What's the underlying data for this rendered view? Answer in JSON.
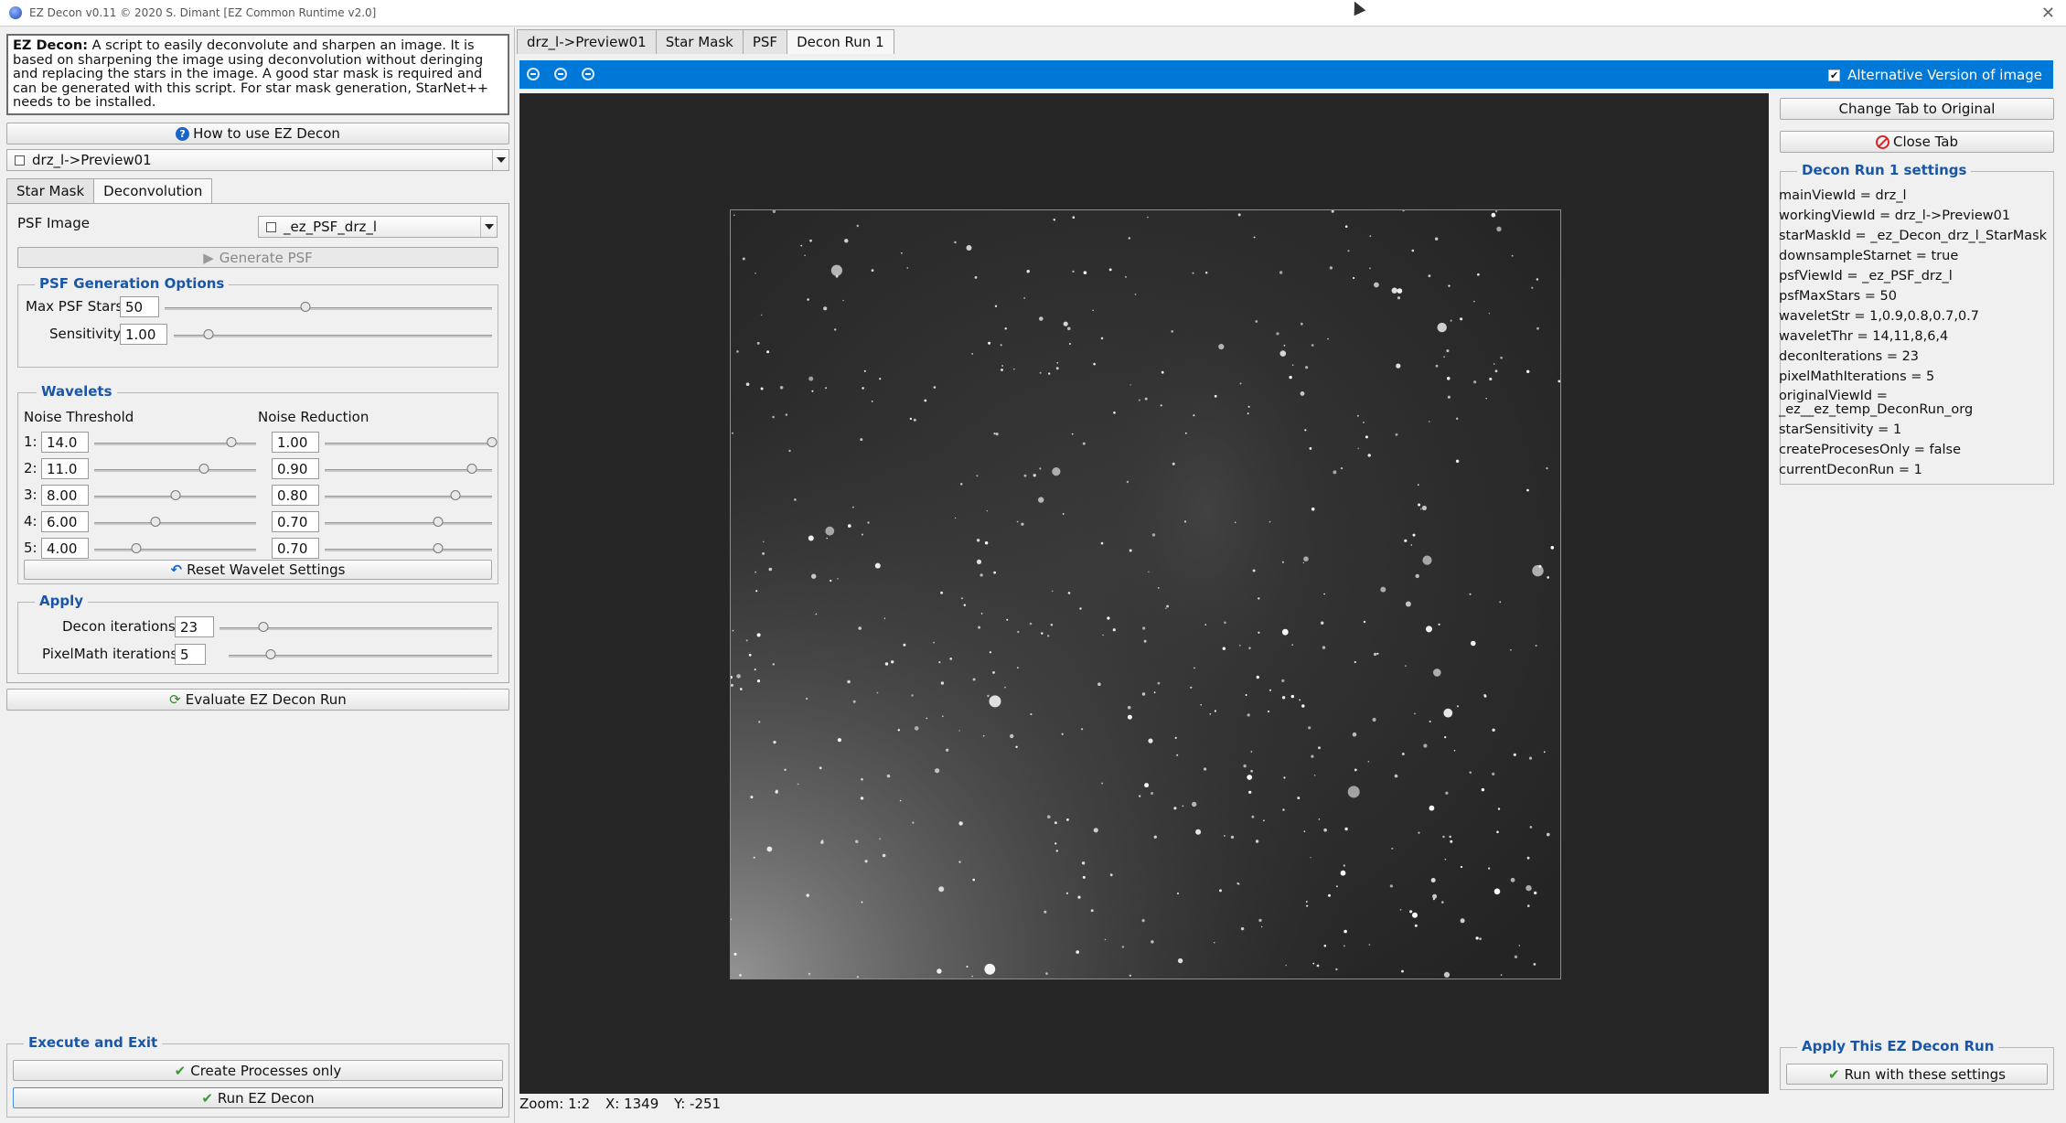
{
  "window": {
    "title": "EZ Decon v0.11 © 2020 S. Dimant [EZ Common Runtime v2.0]",
    "close": "✕"
  },
  "description": {
    "bold": "EZ Decon:",
    "text": " A script to easily deconvolute and sharpen an image. It is based on sharpening the image using deconvolution without deringing and replacing the stars in the image. A good star mask is required and can be generated with this script. For star mask generation, StarNet++ needs to be installed."
  },
  "how_to_label": "How to use EZ Decon",
  "view_combo": "drz_l->Preview01",
  "left_tabs": [
    "Star Mask",
    "Deconvolution"
  ],
  "psf": {
    "label": "PSF Image",
    "combo": "_ez_PSF_drz_l",
    "generate_label": "Generate PSF"
  },
  "psf_options": {
    "title": "PSF Generation Options",
    "max_stars_label": "Max PSF Stars",
    "max_stars_value": "50",
    "max_stars_level": 0.43,
    "sensitivity_label": "Sensitivity",
    "sensitivity_value": "1.00",
    "sensitivity_level": 0.11
  },
  "wavelets": {
    "title": "Wavelets",
    "noise_threshold_label": "Noise Threshold",
    "noise_reduction_label": "Noise Reduction",
    "rows": [
      {
        "label": "1:",
        "threshold": "14.0",
        "t_level": 0.85,
        "reduction": "1.00",
        "r_level": 1.0
      },
      {
        "label": "2:",
        "threshold": "11.0",
        "t_level": 0.68,
        "reduction": "0.90",
        "r_level": 0.88
      },
      {
        "label": "3:",
        "threshold": "8.00",
        "t_level": 0.5,
        "reduction": "0.80",
        "r_level": 0.78
      },
      {
        "label": "4:",
        "threshold": "6.00",
        "t_level": 0.38,
        "reduction": "0.70",
        "r_level": 0.68
      },
      {
        "label": "5:",
        "threshold": "4.00",
        "t_level": 0.26,
        "reduction": "0.70",
        "r_level": 0.68
      }
    ],
    "reset_label": "Reset Wavelet Settings"
  },
  "apply": {
    "title": "Apply",
    "decon_label": "Decon iterations",
    "decon_value": "23",
    "decon_level": 0.16,
    "pixelmath_label": "PixelMath iterations",
    "pixelmath_value": "5",
    "pixelmath_level": 0.16
  },
  "evaluate_label": "Evaluate EZ Decon Run",
  "execute": {
    "title": "Execute and Exit",
    "create_label": "Create Processes only",
    "run_label": "Run EZ Decon"
  },
  "center_tabs": [
    "drz_l->Preview01",
    "Star Mask",
    "PSF",
    "Decon Run 1"
  ],
  "toolbar": {
    "alt_version_label": "Alternative Version of image",
    "alt_version_checked": "✔"
  },
  "status": {
    "zoom": "Zoom: 1:2",
    "x": "X: 1349",
    "y": "Y: -251"
  },
  "right": {
    "change_tab_label": "Change Tab to Original",
    "close_tab_label": "Close Tab",
    "settings_title": "Decon Run 1 settings",
    "settings": [
      "mainViewId = drz_l",
      "workingViewId = drz_l->Preview01",
      "starMaskId = _ez_Decon_drz_l_StarMask",
      "downsampleStarnet = true",
      "psfViewId = _ez_PSF_drz_l",
      "psfMaxStars = 50",
      "waveletStr = 1,0.9,0.8,0.7,0.7",
      "waveletThr = 14,11,8,6,4",
      "deconIterations = 23",
      "pixelMathIterations = 5",
      "originalViewId =\n_ez__ez_temp_DeconRun_org",
      "starSensitivity = 1",
      "createProcesesOnly = false",
      "currentDeconRun = 1"
    ],
    "apply_title": "Apply This EZ Decon Run",
    "run_with_label": "Run with these settings"
  }
}
